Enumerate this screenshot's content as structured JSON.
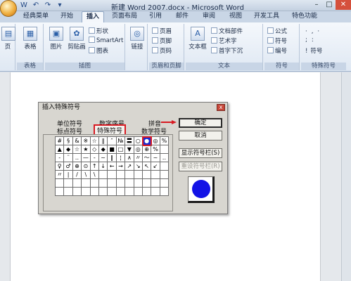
{
  "window": {
    "title": "新建 Word 2007.docx - Microsoft Word",
    "minimize": "–",
    "restore": "□",
    "close": "✕"
  },
  "quick_access": [
    "W",
    "↶",
    "↷",
    "▾"
  ],
  "tabs": [
    "经典菜单",
    "开始",
    "插入",
    "页面布局",
    "引用",
    "邮件",
    "审阅",
    "视图",
    "开发工具",
    "特色功能"
  ],
  "ribbon": {
    "groups": {
      "pages_label": "页",
      "tables_label": "表格",
      "table_btn": "表格",
      "illustrations_label": "插图",
      "picture_btn": "图片",
      "clipart_btn": "剪贴画",
      "shapes_btn": "形状",
      "smartart_btn": "SmartArt",
      "chart_btn": "图表",
      "links_btn": "链接",
      "header_footer_label": "页眉和页脚",
      "header_btn": "页眉",
      "footer_btn": "页脚",
      "pagenum_btn": "页码",
      "text_label": "文本",
      "textbox_btn": "文本框",
      "parts_btn": "文档部件",
      "wordart_btn": "艺术字",
      "dropcap_btn": "首字下沉",
      "symbols_label": "符号",
      "equation_btn": "公式",
      "symbol_btn": "符号",
      "number_btn": "编号",
      "special_label": "特殊符号",
      "special_btn": "符号"
    }
  },
  "dialog": {
    "title": "插入特殊符号",
    "close": "x",
    "tabs_row1": [
      "单位符号",
      "数字序号",
      "拼音"
    ],
    "tabs_row2": [
      "标点符号",
      "特殊符号",
      "数学符号"
    ],
    "active_tab": "特殊符号",
    "symbols": [
      "#",
      "§",
      "&",
      "※",
      "☆",
      "‖",
      "″",
      "№",
      "〓",
      "○",
      "●",
      "◎",
      "%",
      "▲",
      "◆",
      "☆",
      "★",
      "◇",
      "◆",
      "■",
      "□",
      "▼",
      "◎",
      "⊕",
      "%",
      "",
      "-",
      "¨",
      "‥",
      "—",
      "‐",
      "~",
      "‖",
      "¦",
      "∧",
      "〃",
      "〜",
      "~",
      "‥",
      "♀",
      "♂",
      "⊕",
      "⊙",
      "↑",
      "↓",
      "←",
      "→",
      "↗",
      "↘",
      "↖",
      "↙",
      "",
      "〃",
      "|",
      "/",
      "\\",
      "\\",
      "",
      "",
      "",
      "",
      "",
      "",
      "",
      "",
      "",
      "",
      "",
      "",
      "",
      "",
      "",
      "",
      "",
      "",
      "",
      "",
      "",
      "",
      "",
      "",
      "",
      "",
      "",
      "",
      "",
      "",
      "",
      "",
      "",
      ""
    ],
    "selected_symbol": "●",
    "buttons": {
      "ok": "确定",
      "cancel": "取消",
      "show_bar": "显示符号栏(S)",
      "reset_bar": "重设符号栏(R)"
    },
    "colors": {
      "highlight": "#d81a22",
      "preview_dot": "#1212e6"
    }
  }
}
